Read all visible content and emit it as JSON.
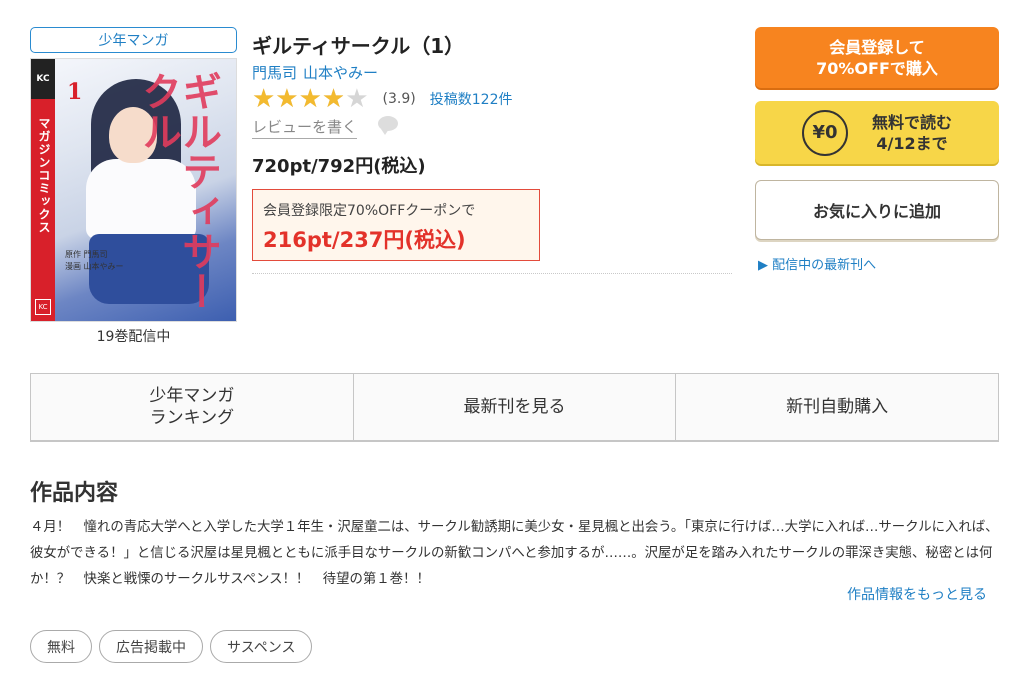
{
  "category_badge": "少年マンガ",
  "cover": {
    "volume_mark": "1",
    "vertical_title": "ギルティサークル",
    "spine_text": "マガジンコミックス",
    "spine_logo": "KC",
    "authors_small": [
      "原作 門馬司",
      "漫画 山本やみー"
    ],
    "corner_mark": "KC"
  },
  "volumes_status": "19巻配信中",
  "title": "ギルティサークル（1）",
  "authors": [
    "門馬司",
    "山本やみー"
  ],
  "rating": {
    "value": 3.9,
    "max": 5,
    "display": "(3.9)",
    "review_count": "投稿数122件"
  },
  "write_review": "レビューを書く",
  "price": "720pt/792円(税込)",
  "coupon": {
    "label": "会員登録限定70%OFFクーポンで",
    "price": "216pt/237円(税込)"
  },
  "buttons": {
    "register_line1": "会員登録して",
    "register_line2": "70%OFFで購入",
    "free_badge": "¥0",
    "free_line1": "無料で読む",
    "free_line2": "4/12まで",
    "favorite": "お気に入りに追加"
  },
  "latest_link": "▶ 配信中の最新刊へ",
  "tabs": [
    {
      "line1": "少年マンガ",
      "line2": "ランキング"
    },
    {
      "line1": "最新刊を見る",
      "line2": ""
    },
    {
      "line1": "新刊自動購入",
      "line2": ""
    }
  ],
  "section_title": "作品内容",
  "description": "４月！　憧れの青応大学へと入学した大学１年生・沢屋童二は、サークル勧誘期に美少女・星見楓と出会う。「東京に行けば…大学に入れば…サークルに入れば、彼女ができる！」と信じる沢屋は星見楓とともに派手目なサークルの新歓コンパへと参加するが……。沢屋が足を踏み入れたサークルの罪深き実態、秘密とは何か！？　快楽と戦慄のサークルサスペンス！！　待望の第１巻！！",
  "more_link": "作品情報をもっと見る",
  "tags": [
    "無料",
    "広告掲載中",
    "サスペンス"
  ],
  "colors": {
    "accent_orange": "#f7841f",
    "accent_yellow": "#f7d648",
    "link_blue": "#1f7fc4",
    "sale_red": "#e3322a",
    "star": "#f3ba2f"
  }
}
